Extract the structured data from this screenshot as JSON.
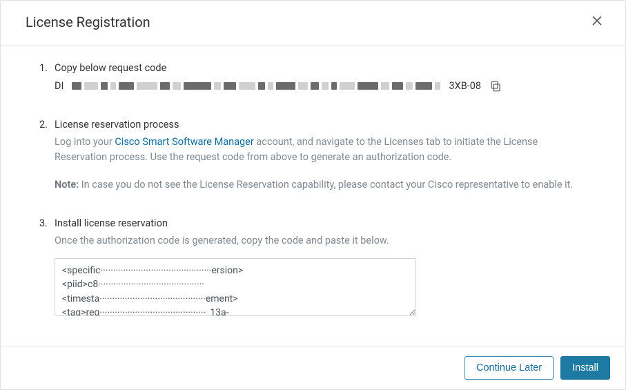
{
  "modal": {
    "title": "License Registration"
  },
  "step1": {
    "num": "1.",
    "title": "Copy below request code",
    "code_prefix": "DI",
    "code_suffix": "3XB-08"
  },
  "step2": {
    "num": "2.",
    "title": "License reservation process",
    "desc_before_link": "Log into your ",
    "link_text": "Cisco Smart Software Manager",
    "desc_after_link": " account, and navigate to the Licenses tab to initiate the License Reservation process. Use the request code from above to generate an authorization code.",
    "note_label": "Note:",
    "note_text": " In case you do not see the License Reservation capability, please contact your Cisco representative to enable it."
  },
  "step3": {
    "num": "3.",
    "title": "Install license reservation",
    "desc": "Once the authorization code is generated, copy the code and paste it below.",
    "textarea_value": "<specific············································ersion>\n<piid>c8··········································\n<timesta··········································ement>\n<tag>reg··········································_13a-"
  },
  "footer": {
    "continue_label": "Continue Later",
    "install_label": "Install"
  }
}
